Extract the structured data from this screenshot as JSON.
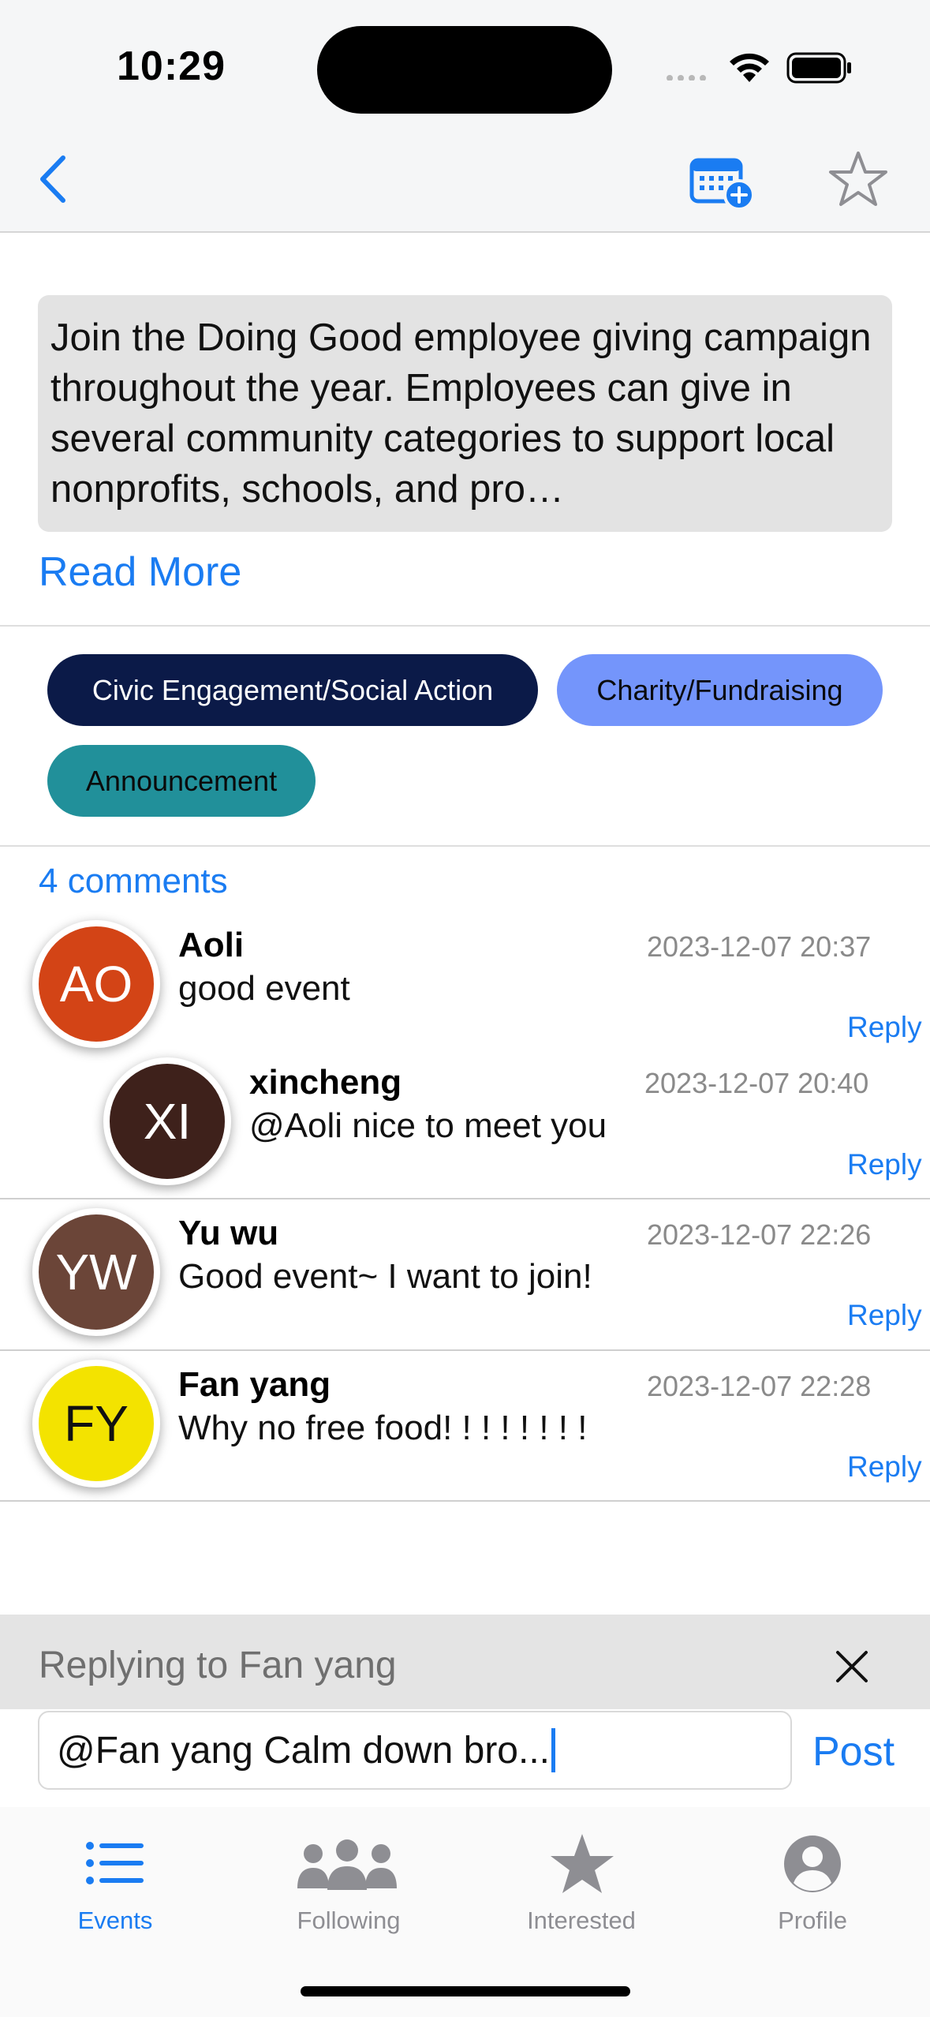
{
  "status_bar": {
    "time": "10:29"
  },
  "nav": {
    "back_icon": "chevron-left-icon",
    "calendar_icon": "calendar-add-icon",
    "star_icon": "star-outline-icon"
  },
  "description": {
    "text": "Join the Doing Good employee giving campaign throughout the year. Employees can give in several community categories to support local nonprofits, schools, and pro…",
    "read_more": "Read More"
  },
  "tags": [
    {
      "label": "Civic Engagement/Social Action",
      "color": "#0b1a48",
      "text_color": "#ffffff"
    },
    {
      "label": "Charity/Fundraising",
      "color": "#7495fb",
      "text_color": "#0a0a0a"
    },
    {
      "label": "Announcement",
      "color": "#21909a",
      "text_color": "#0a0a0a"
    }
  ],
  "comments": {
    "count_label": "4 comments",
    "items": [
      {
        "initials": "AO",
        "avatar_color": "#d34416",
        "avatar_text_color": "#ffffff",
        "name": "Aoli",
        "text": "good event",
        "time": "2023-12-07 20:37",
        "reply": "Reply"
      },
      {
        "initials": "XI",
        "avatar_color": "#3e211b",
        "avatar_text_color": "#ffffff",
        "name": "xincheng",
        "text": "@Aoli nice to meet you",
        "time": "2023-12-07 20:40",
        "reply": "Reply"
      },
      {
        "initials": "YW",
        "avatar_color": "#6b4538",
        "avatar_text_color": "#ffffff",
        "name": "Yu wu",
        "text": "Good event~  I want to join!",
        "time": "2023-12-07 22:26",
        "reply": "Reply"
      },
      {
        "initials": "FY",
        "avatar_color": "#f3e300",
        "avatar_text_color": "#111111",
        "name": "Fan yang",
        "text": "Why no free food! ! ! ! ! ! ! !",
        "time": "2023-12-07 22:28",
        "reply": "Reply"
      }
    ]
  },
  "reply_bar": {
    "label": "Replying to Fan yang",
    "close_icon": "close-icon",
    "input_value": "@Fan yang Calm down bro...",
    "post_label": "Post"
  },
  "tabbar": {
    "tabs": [
      {
        "label": "Events",
        "icon": "list-icon",
        "active": true
      },
      {
        "label": "Following",
        "icon": "people-icon",
        "active": false
      },
      {
        "label": "Interested",
        "icon": "star-filled-icon",
        "active": false
      },
      {
        "label": "Profile",
        "icon": "person-circle-icon",
        "active": false
      }
    ],
    "active_color": "#1a7cf2",
    "inactive_color": "#8e8e93"
  }
}
